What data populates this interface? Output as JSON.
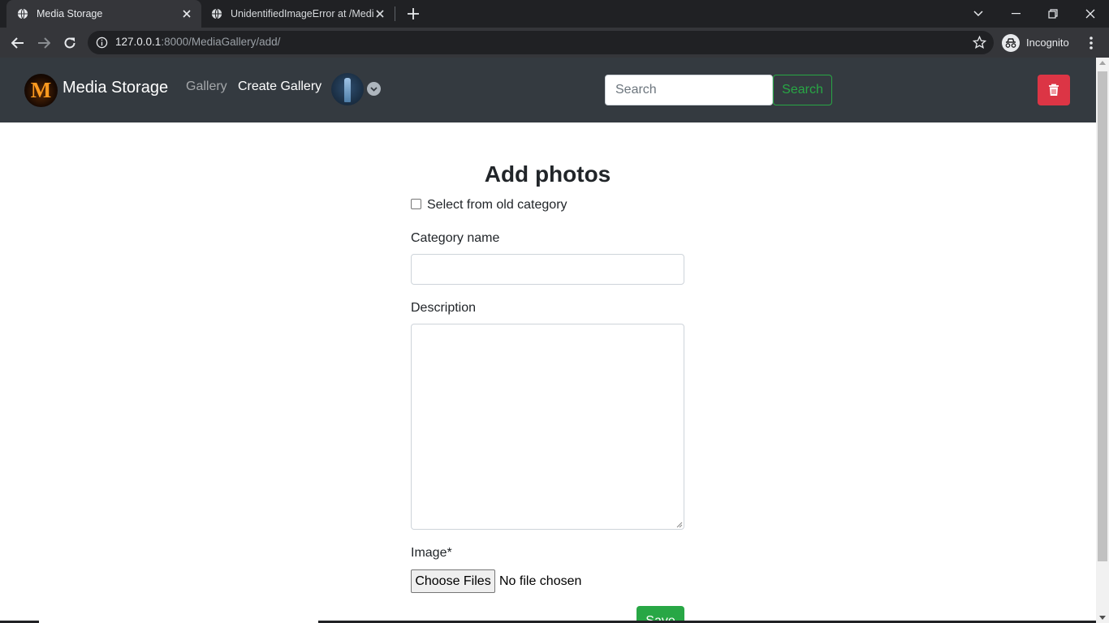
{
  "browser": {
    "tabs": [
      {
        "title": "Media Storage",
        "active": true
      },
      {
        "title": "UnidentifiedImageError at /MediaGallery/add/",
        "active": false
      }
    ],
    "url_host": "127.0.0.1",
    "url_rest": ":8000/MediaGallery/add/",
    "profile_label": "Incognito"
  },
  "navbar": {
    "logo_letter": "M",
    "brand": "Media Storage",
    "links": {
      "gallery": "Gallery",
      "create_gallery": "Create Gallery"
    },
    "search": {
      "placeholder": "Search",
      "button": "Search"
    },
    "colors": {
      "bg": "#343a40",
      "success": "#28a745",
      "danger": "#dc3545"
    }
  },
  "form": {
    "title": "Add photos",
    "old_category_label": "Select from old category",
    "old_category_checked": false,
    "category_label": "Category name",
    "category_value": "",
    "description_label": "Description",
    "description_value": "",
    "image_label": "Image*",
    "file_button": "Choose Files",
    "file_status": "No file chosen",
    "save_button": "Save"
  },
  "icons": [
    "globe-icon",
    "close-icon",
    "plus-icon",
    "back-icon",
    "forward-icon",
    "reload-icon",
    "info-icon",
    "star-icon",
    "incognito-icon",
    "kebab-menu-icon",
    "trash-icon",
    "chevron-down-icon"
  ]
}
